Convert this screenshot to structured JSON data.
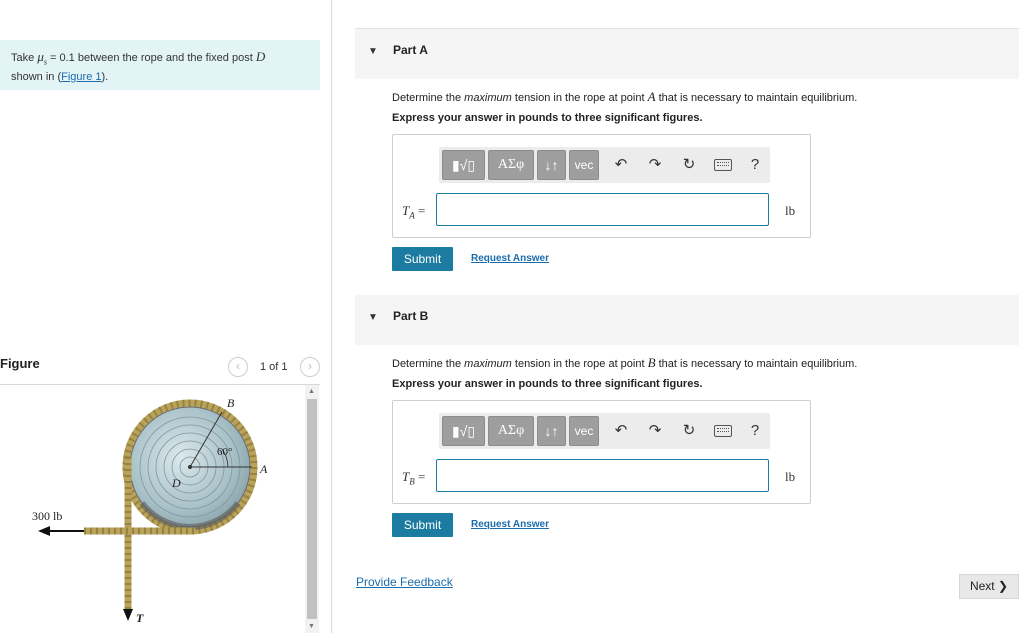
{
  "intro": {
    "take": "Take",
    "mu_symbol": "μ",
    "mu_sub": "s",
    "text_mid": "= 0.1 between the rope and the fixed post",
    "post": "D",
    "text_line2": "shown in (",
    "figure_link": "Figure 1",
    "text_end": ")."
  },
  "figure": {
    "title": "Figure",
    "pager_text": "1 of 1",
    "prev_icon": "chevron-left-icon",
    "next_icon": "chevron-right-icon",
    "labels": {
      "B": "B",
      "A": "A",
      "D": "D",
      "T": "T",
      "angle": "60°",
      "load": "300 lb"
    }
  },
  "parts": [
    {
      "title": "Part A",
      "question_pre": "Determine the",
      "question_em": "maximum",
      "question_mid": "tension in the rope at point",
      "point": "A",
      "question_post": "that is necessary to maintain equilibrium.",
      "instruction": "Express your answer in pounds to three significant figures.",
      "var_main": "T",
      "var_sub": "A",
      "equals": "=",
      "input_value": "",
      "unit": "lb",
      "submit_label": "Submit",
      "request_label": "Request Answer"
    },
    {
      "title": "Part B",
      "question_pre": "Determine the",
      "question_em": "maximum",
      "question_mid": "tension in the rope at point",
      "point": "B",
      "question_post": "that is necessary to maintain equilibrium.",
      "instruction": "Express your answer in pounds to three significant figures.",
      "var_main": "T",
      "var_sub": "B",
      "equals": "=",
      "input_value": "",
      "unit": "lb",
      "submit_label": "Submit",
      "request_label": "Request Answer"
    }
  ],
  "toolbar": {
    "template_icon": "template-radical-icon",
    "greek_label": "ΑΣφ",
    "arrows_label": "↓↑",
    "vec_label": "vec",
    "undo_icon": "undo-icon",
    "redo_icon": "redo-icon",
    "reset_icon": "reset-icon",
    "keyboard_icon": "keyboard-icon",
    "help_label": "?"
  },
  "footer": {
    "feedback": "Provide Feedback",
    "next": "Next"
  },
  "colors": {
    "accent": "#1b7ba0",
    "intro_bg": "#e3f4f6",
    "toolbar_btn": "#9e9e9e",
    "link": "#1b6cad"
  }
}
